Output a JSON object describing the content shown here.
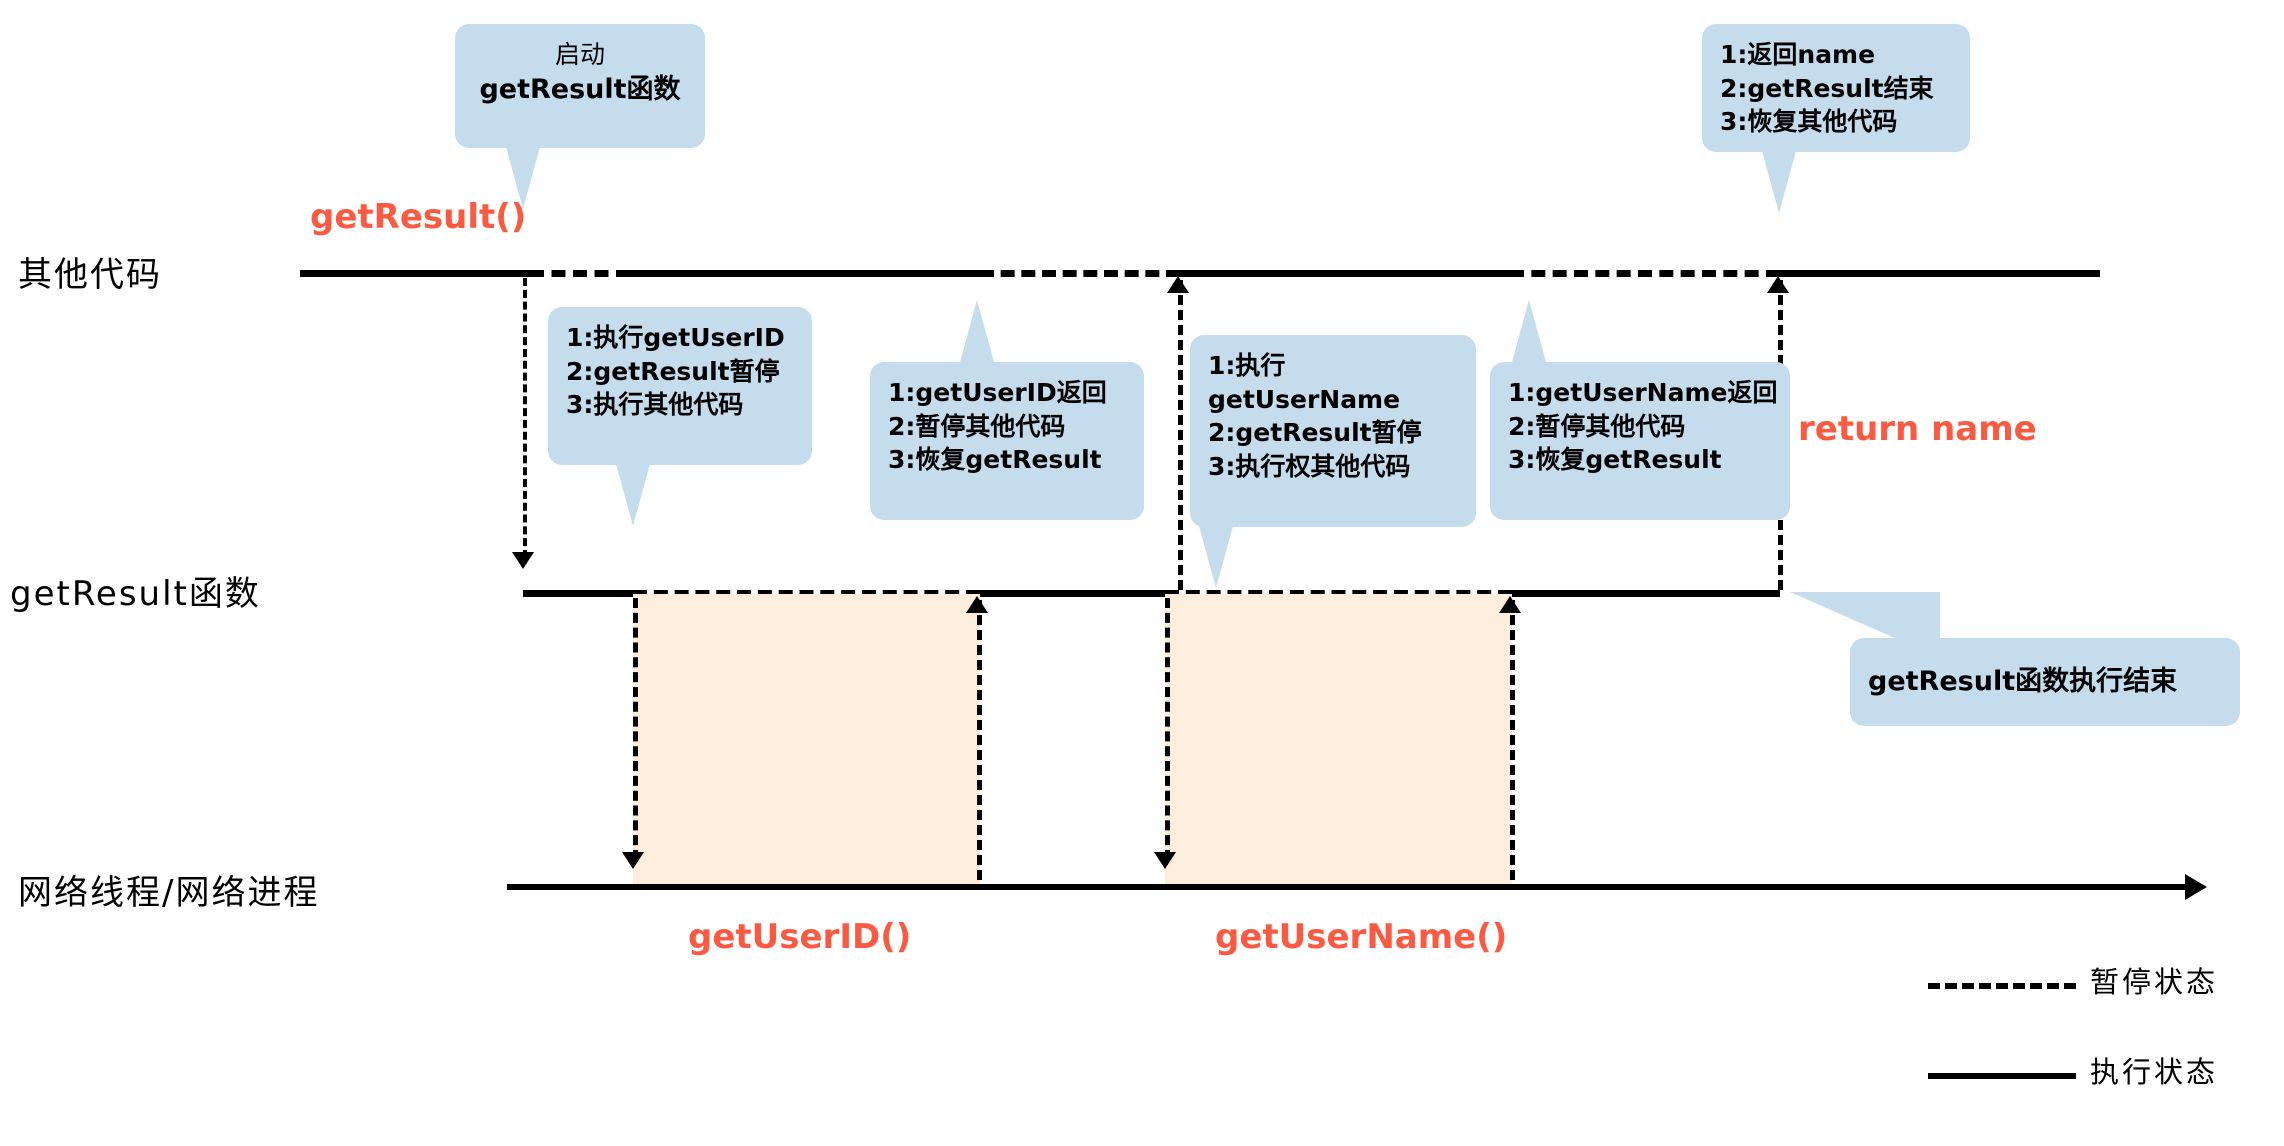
{
  "diagram": {
    "lanes": [
      {
        "id": "other-code",
        "label": "其他代码"
      },
      {
        "id": "get-result",
        "label": "getResult函数"
      },
      {
        "id": "net-thread",
        "label": "网络线程/网络进程"
      }
    ],
    "annotations": {
      "call_get_result": "getResult()",
      "return_name": "return name",
      "get_user_id": "getUserID()",
      "get_user_name": "getUserName()"
    },
    "callouts": [
      {
        "id": "start-get-result",
        "lines": [
          "启动",
          "getResult函数"
        ]
      },
      {
        "id": "run-get-user-id",
        "lines": [
          "1:执行getUserID",
          "2:getResult暂停",
          "3:执行其他代码"
        ]
      },
      {
        "id": "get-user-id-returned",
        "lines": [
          "1:getUserID返回",
          "2:暂停其他代码",
          "3:恢复getResult"
        ]
      },
      {
        "id": "run-get-user-name",
        "lines": [
          "1:执行",
          "getUserName",
          "2:getResult暂停",
          "3:执行权其他代码"
        ]
      },
      {
        "id": "get-user-name-returned",
        "lines": [
          "1:getUserName返回",
          "2:暂停其他代码",
          "3:恢复getResult"
        ]
      },
      {
        "id": "resume-other-code",
        "lines": [
          "1:返回name",
          "2:getResult结束",
          "3:恢复其他代码"
        ]
      },
      {
        "id": "get-result-finished",
        "lines": [
          "getResult函数执行结束"
        ]
      }
    ],
    "legend": [
      {
        "id": "paused",
        "style": "dashed",
        "label": "暂停状态"
      },
      {
        "id": "running",
        "style": "solid",
        "label": "执行状态"
      }
    ],
    "colors": {
      "accent_red": "#fa5a42",
      "callout_blue": "#c5dcec",
      "network_block": "#fceddc",
      "line": "#000000"
    }
  }
}
